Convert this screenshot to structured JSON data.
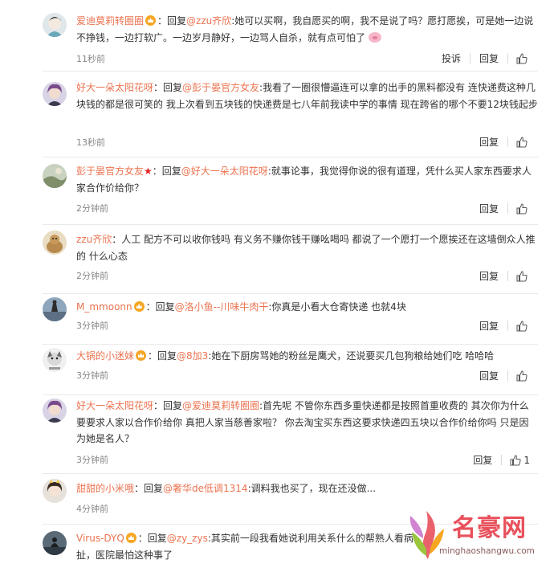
{
  "comments": [
    {
      "user": "爱迪莫莉转圈圈",
      "badge": true,
      "prefix": "：回复",
      "mention": "@zzu齐欣",
      "body": ":她可以买啊，我自愿买的啊，我不是说了吗？愿打愿挨，可是她一边说不挣钱，一边打软广。一边岁月静好，一边骂人自杀，就有点可怕了",
      "time": "11秒前",
      "report": "投诉",
      "reply": "回复",
      "likes": ""
    },
    {
      "user": "好大一朵太阳花呀",
      "badge": false,
      "prefix": "：回复",
      "mention": "@彭于晏官方女友",
      "body": ":我看了一圈很懵逼连可以拿的出手的黑料都没有 连快递费这种几块钱的都是很可笑的 我上次看到五块钱的快递费是七八年前我读中学的事情 现在跨省的哪个不要12块钱起步",
      "time": "13秒前",
      "reply": "回复",
      "likes": ""
    },
    {
      "user": "彭于晏官方女友",
      "star": "★",
      "prefix": "：回复",
      "mention": "@好大一朵太阳花呀",
      "body": ":就事论事，我觉得你说的很有道理，凭什么买人家东西要求人家合作价给你？",
      "time": "2分钟前",
      "reply": "回复",
      "likes": ""
    },
    {
      "user": "zzu齐欣",
      "badge": false,
      "prefix": "：人工 配方不可以收你钱吗 有义务不赚你钱干赚吆喝吗 都说了一个愿打一个愿挨还在这墙倒众人推的 什么心态",
      "mention": "",
      "body": "",
      "time": "2分钟前",
      "reply": "回复",
      "likes": ""
    },
    {
      "user": "M_mmoonn",
      "badge": true,
      "prefix": "：回复",
      "mention": "@洛小鱼--川味牛肉干",
      "body": ":你真是小看大仓寄快递 也就4块",
      "time": "3分钟前",
      "reply": "回复",
      "likes": ""
    },
    {
      "user": "大锅的小迷妹",
      "badge": true,
      "prefix": "：回复",
      "mention": "@8加3",
      "body": ":她在下厨房骂她的粉丝是鹰犬，还说要买几包狗粮给她们吃 哈哈哈",
      "time": "3分钟前",
      "reply": "回复",
      "likes": ""
    },
    {
      "user": "好大一朵太阳花呀",
      "badge": false,
      "prefix": "：回复",
      "mention": "@爱迪莫莉转圈圈",
      "body": ":首先呢 不管你东西多重快递都是按照首重收费的 其次你为什么要要求人家以合作价给你 真把人家当慈善家啦？ 你去淘宝买东西这要求快递四五块以合作价给你吗 只是因为她是名人？",
      "time": "3分钟前",
      "reply": "回复",
      "likes": "1"
    },
    {
      "user": "甜甜的小米哦",
      "badge": false,
      "prefix": "：回复",
      "mention": "@奢华de低调1314",
      "body": ":调料我也买了，现在还没做...",
      "time": "4分钟前",
      "reply": "回复",
      "likes": ""
    },
    {
      "user": "Virus-DYQ",
      "badge": true,
      "prefix": "：回复",
      "mention": "@zy_zys",
      "body": ":其实前一段我看她说利用关系什么的帮熟人看病 扯，医院最怕这种事了",
      "time": "",
      "reply": "",
      "likes": ""
    }
  ],
  "watermark": {
    "name": "名豪网",
    "url": "minghaoshangwu.com"
  },
  "colors": {
    "username": "#eb7350",
    "text": "#333333",
    "time": "#888888",
    "divider": "#eaeaea"
  },
  "icons": [
    "avatar",
    "vip-badge-icon",
    "thumbs-up-icon",
    "pig-emoji-icon",
    "red-star-icon"
  ]
}
